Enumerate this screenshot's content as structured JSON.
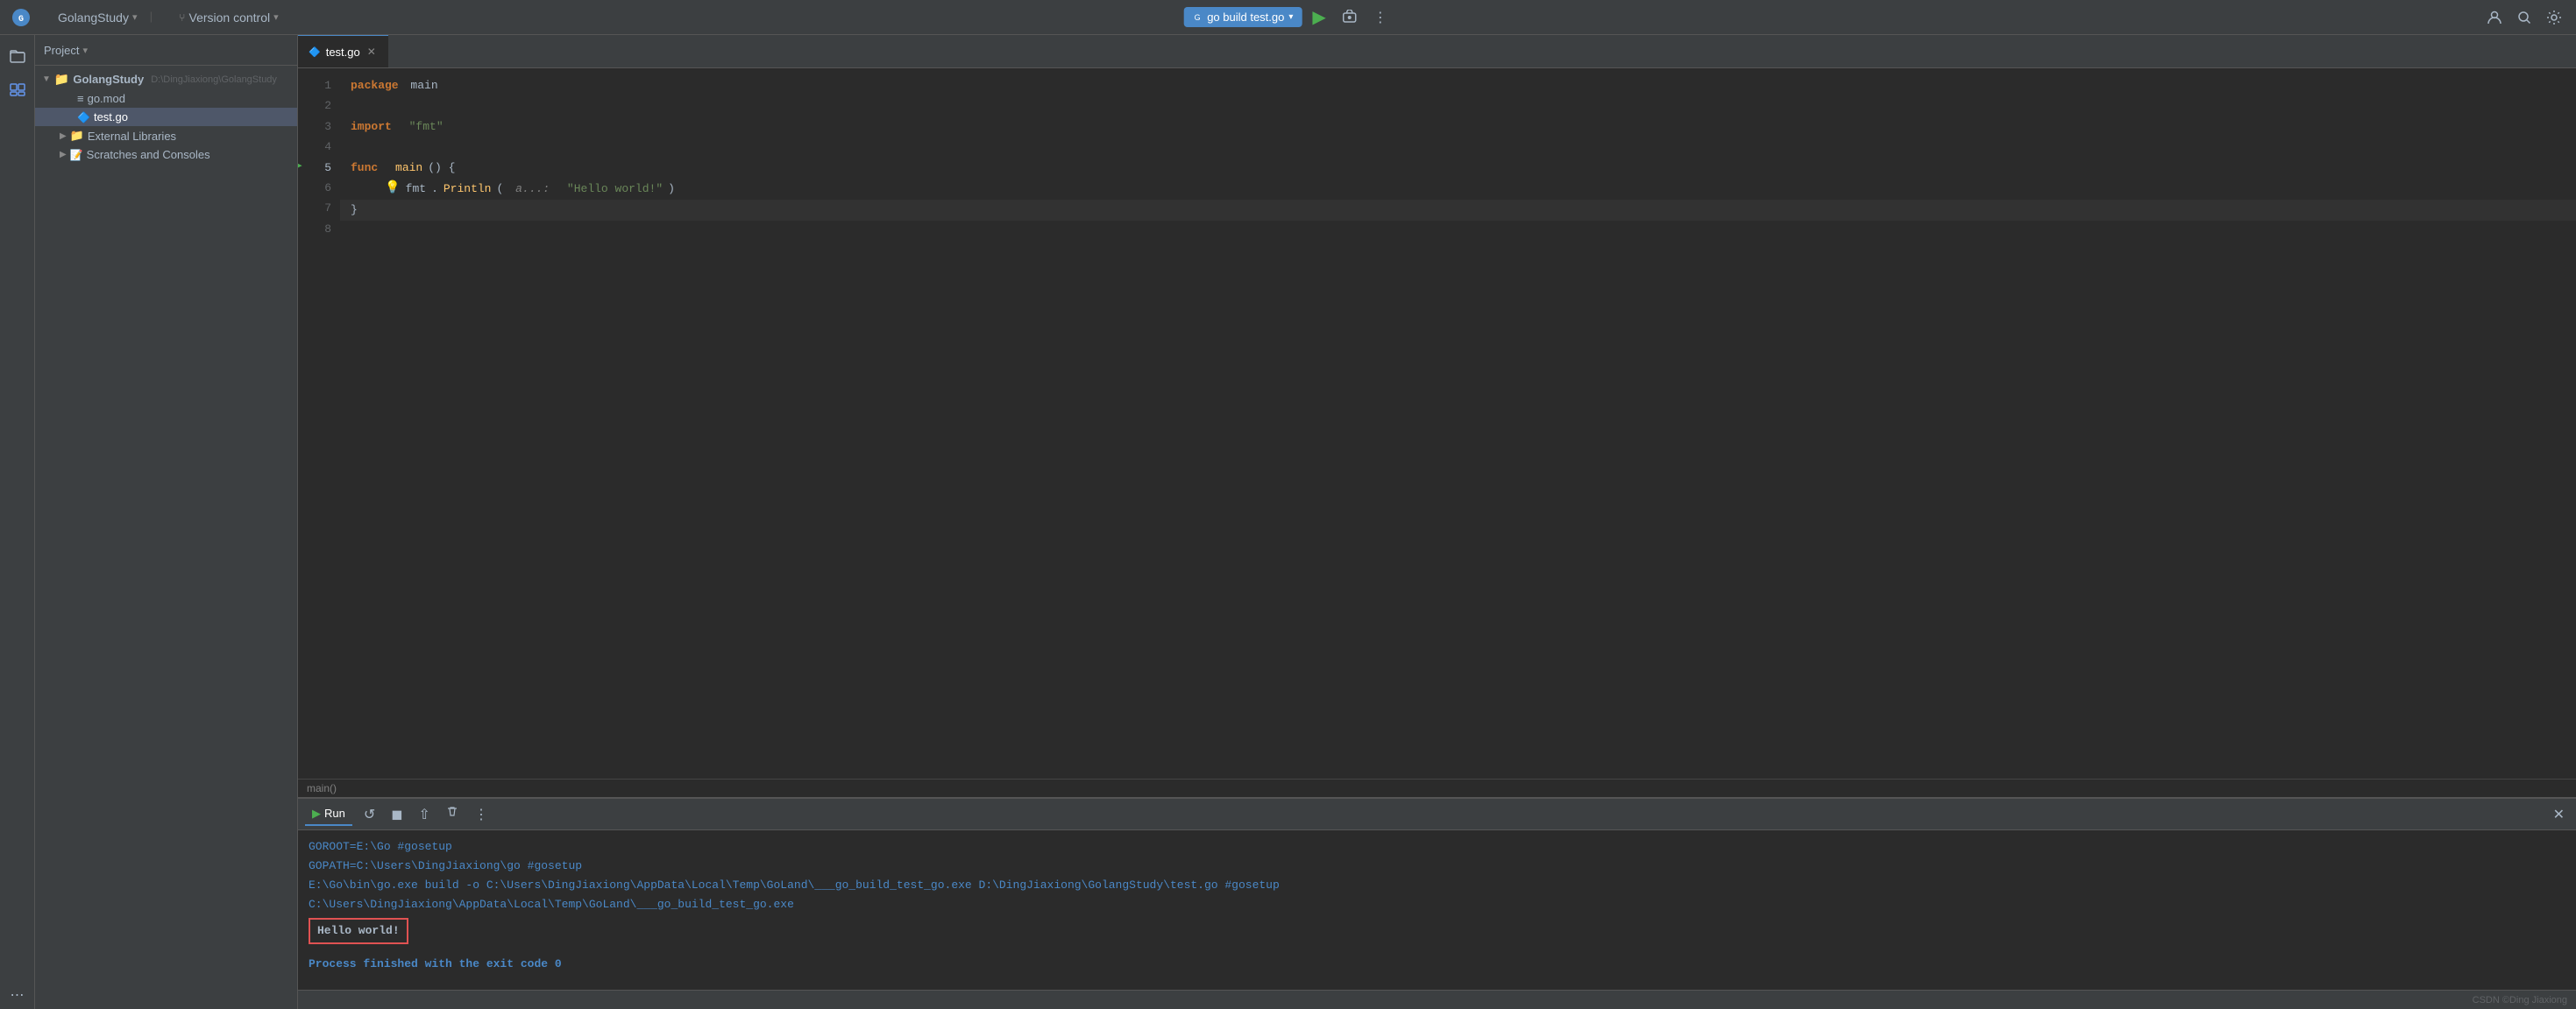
{
  "titlebar": {
    "app_name": "GolangStudy",
    "version_control": "Version control",
    "run_config": "go build test.go",
    "chevron": "▾",
    "hamburger": "☰",
    "more_icon": "⋮"
  },
  "project_panel": {
    "title": "Project",
    "chevron": "▾",
    "root_name": "GolangStudy",
    "root_path": "D:\\DingJiaxiong\\GolangStudy",
    "items": [
      {
        "label": "go.mod",
        "type": "mod",
        "indent": 1
      },
      {
        "label": "test.go",
        "type": "go",
        "indent": 1,
        "selected": true
      },
      {
        "label": "External Libraries",
        "type": "folder",
        "indent": 0
      },
      {
        "label": "Scratches and Consoles",
        "type": "scratches",
        "indent": 0
      }
    ]
  },
  "editor": {
    "tab_name": "test.go",
    "breadcrumb": "main()",
    "lines": [
      {
        "num": "1",
        "content": "package main"
      },
      {
        "num": "2",
        "content": ""
      },
      {
        "num": "3",
        "content": "import \"fmt\""
      },
      {
        "num": "4",
        "content": ""
      },
      {
        "num": "5",
        "content": "func main() {",
        "run_icon": true
      },
      {
        "num": "6",
        "content": "    fmt.Println( a...: \"Hello world!\")",
        "lightbulb": true
      },
      {
        "num": "7",
        "content": "}"
      },
      {
        "num": "8",
        "content": ""
      }
    ]
  },
  "bottom_panel": {
    "tab_label": "Run",
    "console_lines": [
      "GOROOT=E:\\Go #gosetup",
      "GOPATH=C:\\Users\\DingJiaxiong\\go #gosetup",
      "E:\\Go\\bin\\go.exe build -o C:\\Users\\DingJiaxiong\\AppData\\Local\\Temp\\GoLand\\___go_build_test_go.exe D:\\DingJiaxiong\\GolangStudy\\test.go #gosetup",
      "C:\\Users\\DingJiaxiong\\AppData\\Local\\Temp\\GoLand\\___go_build_test_go.exe"
    ],
    "hello_world": "Hello world!",
    "process_finished": "Process finished with the exit code 0"
  },
  "status_bar": {
    "attribution": "CSDN ©Ding Jiaxiong"
  },
  "icons": {
    "logo": "🔵",
    "folder": "📁",
    "file_go": "🔷",
    "run": "▶",
    "rerun": "↺",
    "stop": "◼",
    "scroll_up": "⇧",
    "trash": "🗑",
    "more": "⋮",
    "close": "✕",
    "project_folder": "📂",
    "mod_file": "≡",
    "vc_branch": "⑂",
    "scratches": "≡📝",
    "settings_gear": "⚙",
    "search_icon": "🔍",
    "user_icon": "👤",
    "play_icon": "▶",
    "gear_icon": "⚙"
  }
}
